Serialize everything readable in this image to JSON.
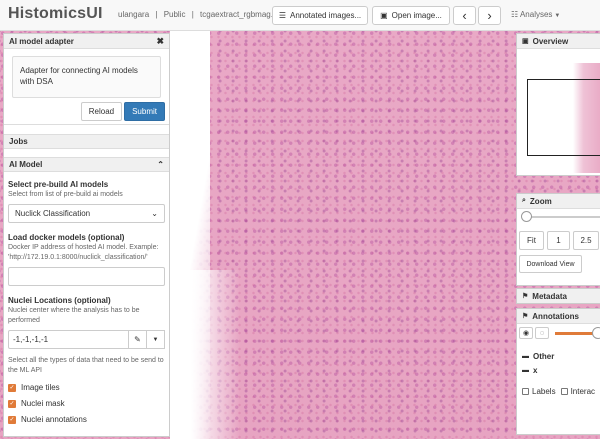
{
  "header": {
    "brand": "HistomicsUI",
    "user": "ulangara",
    "collection": "Public",
    "file": "tcgaextract_rgbmag.tiff",
    "annotated_images_label": "Annotated images...",
    "open_image_label": "Open image...",
    "prev_label": "‹",
    "next_label": "›",
    "analyses_label": "Analyses"
  },
  "left_panel": {
    "adapter": {
      "title": "AI model adapter",
      "close": "✖",
      "description": "Adapter for connecting AI models with DSA",
      "reload_label": "Reload",
      "submit_label": "Submit"
    },
    "jobs": {
      "title": "Jobs"
    },
    "ai_model": {
      "title": "AI Model",
      "prebuild_label": "Select pre-build AI models",
      "prebuild_help": "Select from list of pre-build ai models",
      "prebuild_value": "Nuclick Classification",
      "docker_label": "Load docker models (optional)",
      "docker_help": "Docker IP address of hosted AI model. Example: 'http://172.19.0.1:8000/nuclick_classification/'",
      "docker_value": "",
      "nuclei_label": "Nuclei Locations (optional)",
      "nuclei_help": "Nuclei center where the analysis has to be performed",
      "nuclei_value": "-1,-1,-1,-1",
      "types_help": "Select all the types of data that need to be send to the ML API",
      "checkboxes": [
        {
          "label": "Image tiles",
          "checked": true
        },
        {
          "label": "Nuclei mask",
          "checked": true
        },
        {
          "label": "Nuclei annotations",
          "checked": true
        }
      ]
    }
  },
  "right_panel": {
    "overview": {
      "title": "Overview"
    },
    "zoom": {
      "title": "Zoom",
      "buttons": [
        "Fit",
        "1",
        "2.5"
      ],
      "download_label": "Download View"
    },
    "metadata": {
      "title": "Metadata"
    },
    "annotations": {
      "title": "Annotations",
      "groups": [
        "Other",
        "x"
      ],
      "labels_label": "Labels",
      "interact_label": "Interac"
    }
  },
  "colors": {
    "primary": "#337ab7",
    "accent_orange": "#e07b39",
    "tissue_pink": "#e8a8c4"
  }
}
